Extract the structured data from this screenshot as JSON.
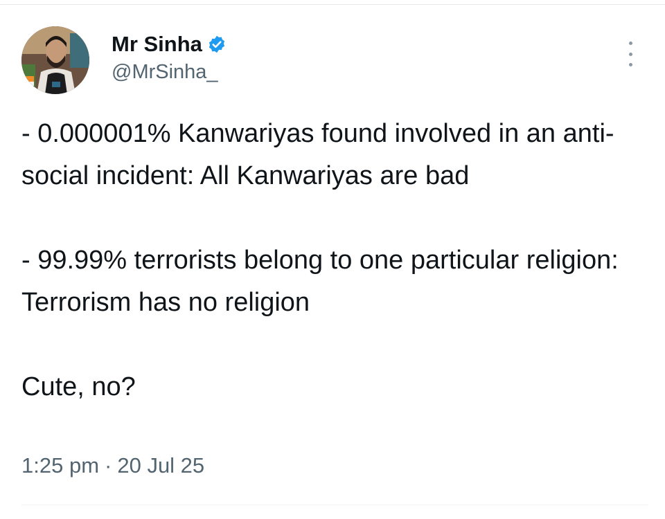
{
  "author": {
    "display_name": "Mr Sinha",
    "handle": "@MrSinha_",
    "avatar_icon": "profile-photo",
    "verified_icon": "verified-badge-icon",
    "verified_color": "#1d9bf0"
  },
  "tweet": {
    "paragraphs": [
      "- 0.000001% Kanwariyas found involved in an anti-social incident: All Kanwariyas are bad",
      "- 99.99% terrorists belong to one particular religion: Terrorism has no religion",
      "Cute, no?"
    ],
    "time": "1:25 pm",
    "separator": "·",
    "date": "20 Jul 25"
  },
  "colors": {
    "text": "#0f1419",
    "secondary": "#536471"
  },
  "menu": {
    "icon": "more-options-icon"
  }
}
